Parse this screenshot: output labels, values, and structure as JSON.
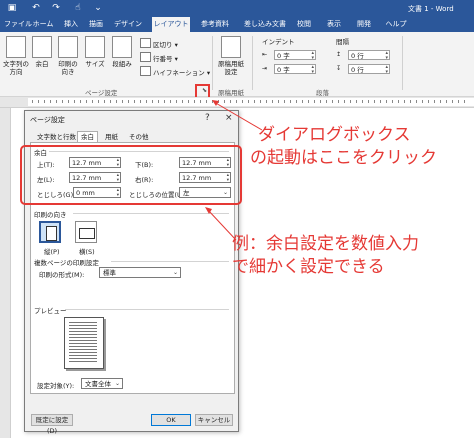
{
  "titlebar": {
    "doc_title": "文書 1 - Word",
    "qa_icons": [
      "save-icon",
      "undo-icon",
      "redo-icon",
      "touch-icon",
      "customize-icon"
    ]
  },
  "tabs": [
    {
      "label": "ファイル"
    },
    {
      "label": "ホーム"
    },
    {
      "label": "挿入"
    },
    {
      "label": "描画"
    },
    {
      "label": "デザイン"
    },
    {
      "label": "レイアウト",
      "active": true
    },
    {
      "label": "参考資料"
    },
    {
      "label": "差し込み文書"
    },
    {
      "label": "校閲"
    },
    {
      "label": "表示"
    },
    {
      "label": "開発"
    },
    {
      "label": "ヘルプ"
    }
  ],
  "ribbon": {
    "text_direction": "文字列の\n方向",
    "margins": "余白",
    "orientation": "印刷の\n向き",
    "size": "サイズ",
    "columns": "段組み",
    "breaks": "区切り",
    "line_numbers": "行番号",
    "hyphenation": "ハイフネーション",
    "page_setup_group": "ページ設定",
    "genko": "原稿用紙\n設定",
    "genko_group": "原稿用紙",
    "indent_label": "インデント",
    "spacing_label": "間隔",
    "indent_left": "0 字",
    "indent_right": "0 字",
    "space_before": "0 行",
    "space_after": "0 行",
    "paragraph_group": "段落",
    "launcher": "⬊"
  },
  "dialog": {
    "title": "ページ設定",
    "help": "?",
    "close": "×",
    "tabs": [
      "文字数と行数",
      "余白",
      "用紙",
      "その他"
    ],
    "margins_section": "余白",
    "top_label": "上(T):",
    "top_value": "12.7 mm",
    "bottom_label": "下(B):",
    "bottom_value": "12.7 mm",
    "left_label": "左(L):",
    "left_value": "12.7 mm",
    "right_label": "右(R):",
    "right_value": "12.7 mm",
    "gutter_label": "とじしろ(G):",
    "gutter_value": "0 mm",
    "gutter_pos_label": "とじしろの位置(U):",
    "gutter_pos_value": "左",
    "orientation_section": "印刷の向き",
    "portrait": "縦(P)",
    "landscape": "横(S)",
    "multi_section": "複数ページの印刷設定",
    "print_format_label": "印刷の形式(M):",
    "print_format_value": "標準",
    "preview_section": "プレビュー",
    "apply_label": "設定対象(Y):",
    "apply_value": "文書全体",
    "default_button": "既定に設定(D)",
    "ok_button": "OK",
    "cancel_button": "キャンセル"
  },
  "annotations": {
    "note1_line1": "ダイアログボックス",
    "note1_line2": "の起動はここをクリック",
    "note2_line1": "例：余白設定を数値入力",
    "note2_line2": "で細かく設定できる",
    "color": "#e53935"
  }
}
